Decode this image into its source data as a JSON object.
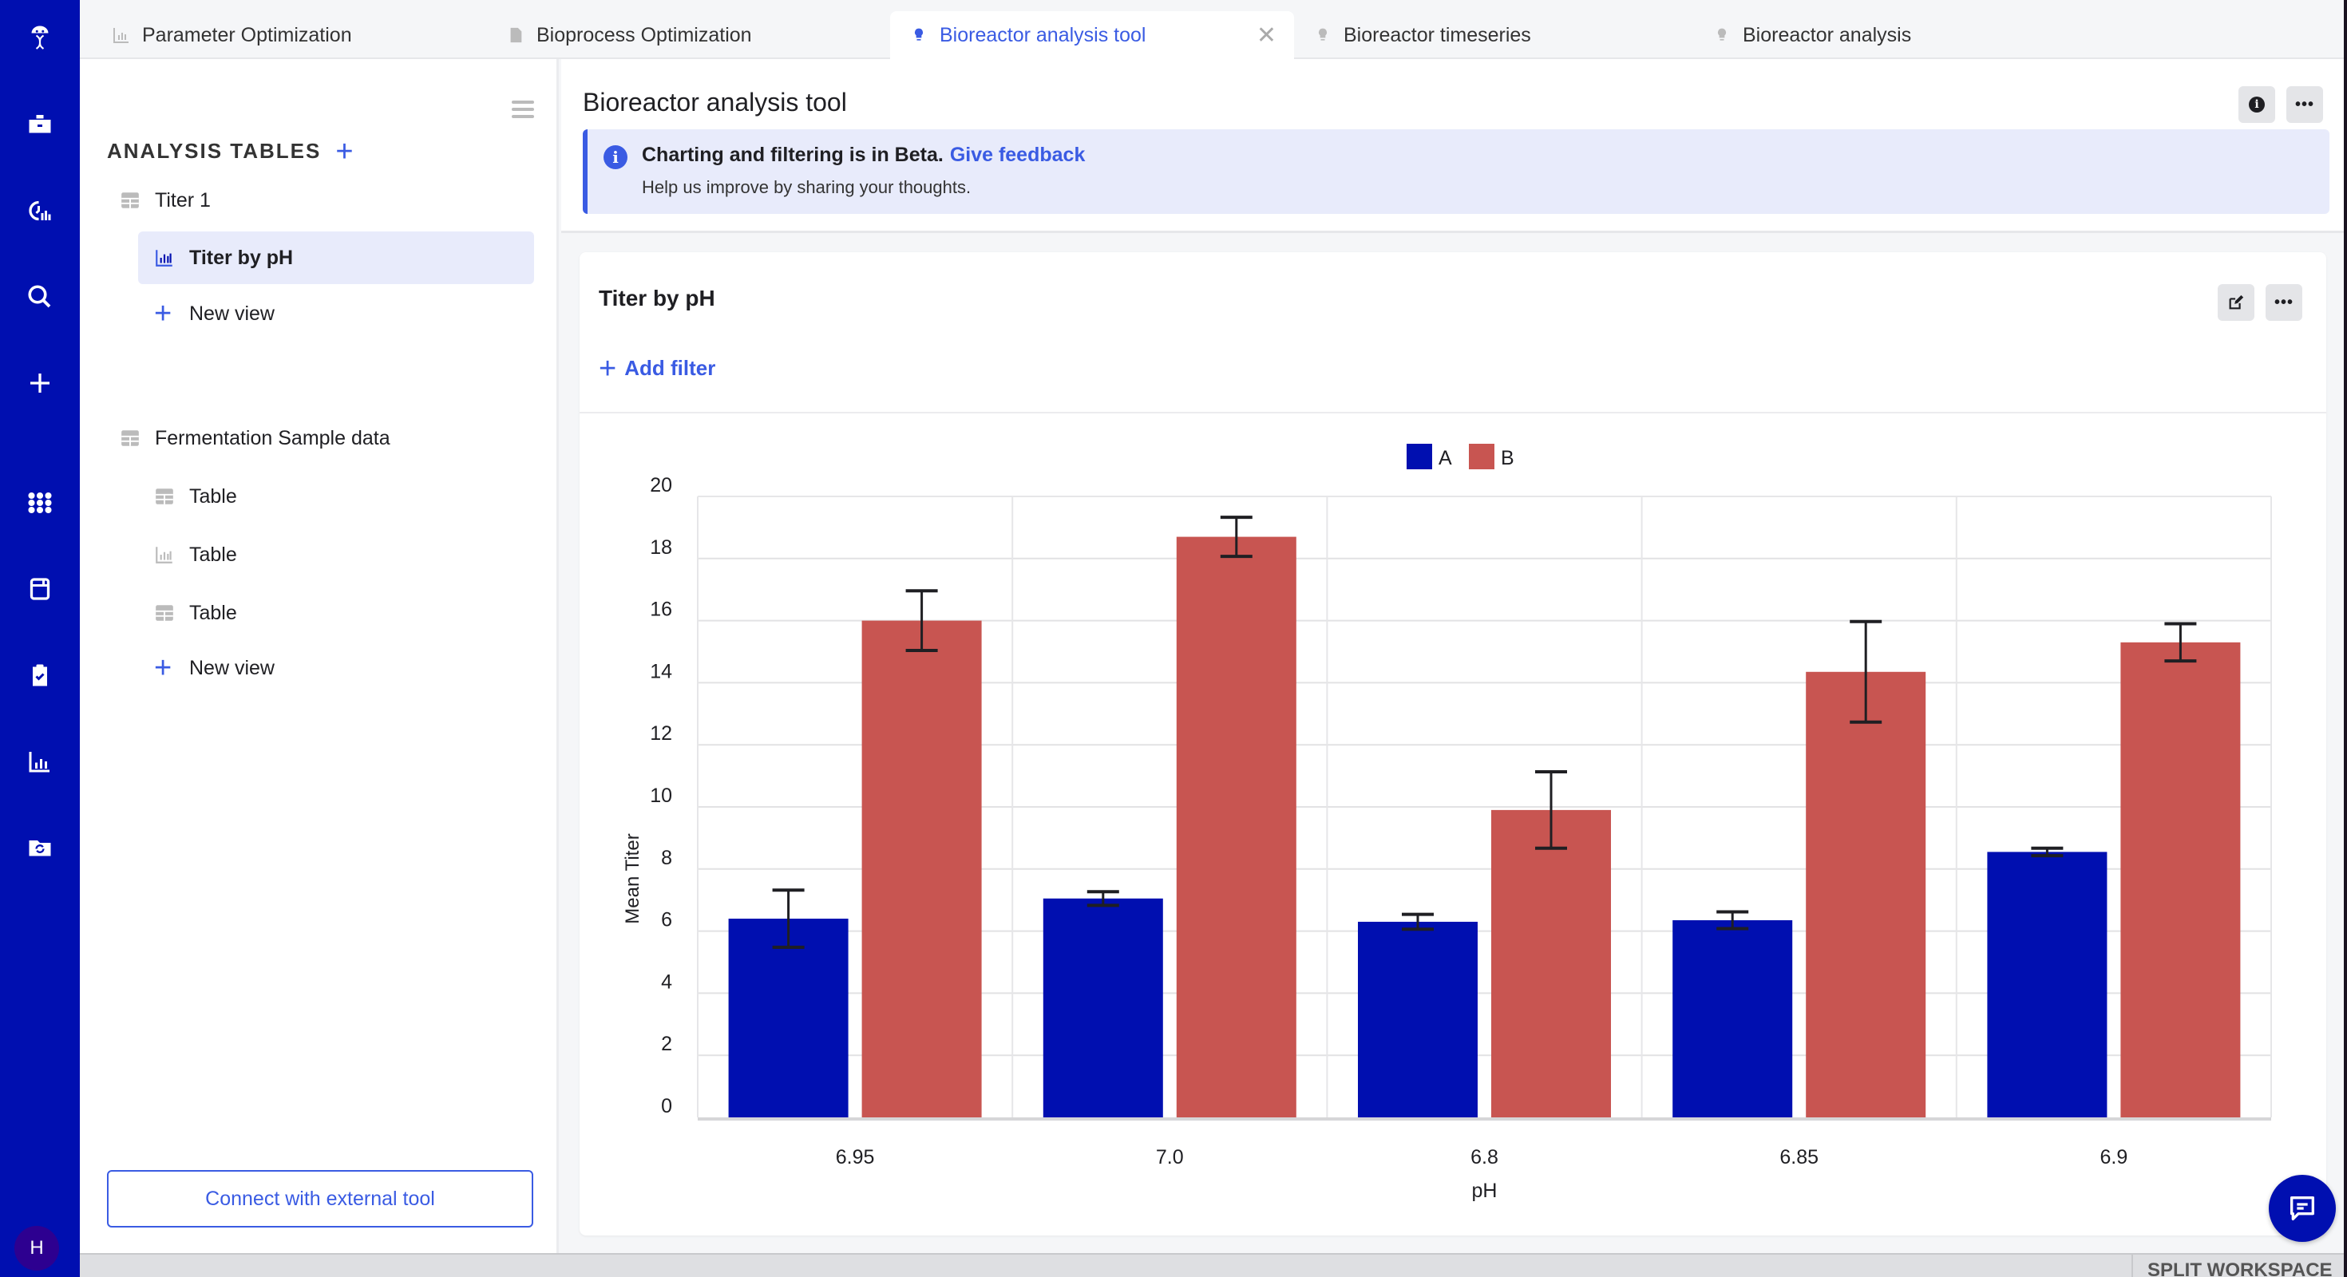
{
  "tabs": [
    {
      "label": "Parameter Optimization",
      "icon": "bar-chart-icon",
      "active": false
    },
    {
      "label": "Bioprocess Optimization",
      "icon": "document-icon",
      "active": false
    },
    {
      "label": "Bioreactor analysis tool",
      "icon": "lightbulb-icon",
      "active": true
    },
    {
      "label": "Bioreactor timeseries",
      "icon": "lightbulb-icon",
      "active": false
    },
    {
      "label": "Bioreactor analysis",
      "icon": "lightbulb-icon",
      "active": false
    }
  ],
  "rail": {
    "icons": [
      "logo-icon",
      "briefcase-icon",
      "analytics-icon",
      "search-icon",
      "plus-icon",
      "apps-grid-icon",
      "notebook-icon",
      "clipboard-check-icon",
      "bar-chart-icon",
      "folder-sync-icon"
    ],
    "avatar_initial": "H"
  },
  "left_panel": {
    "section_title": "ANALYSIS TABLES",
    "items": [
      {
        "label": "Titer 1",
        "icon": "table-icon",
        "level": 0
      },
      {
        "label": "Titer by pH",
        "icon": "bar-chart-icon",
        "level": 1,
        "selected": true
      },
      {
        "label": "New view",
        "icon": "plus-icon",
        "level": 1
      },
      {
        "label": "Fermentation Sample data",
        "icon": "table-icon",
        "level": 0
      },
      {
        "label": "Table",
        "icon": "table-icon",
        "level": 1
      },
      {
        "label": "Table",
        "icon": "bar-chart-icon",
        "level": 1
      },
      {
        "label": "Table",
        "icon": "table-icon",
        "level": 1
      },
      {
        "label": "New view",
        "icon": "plus-icon",
        "level": 1
      }
    ],
    "connect_button": "Connect with external tool"
  },
  "header": {
    "title": "Bioreactor analysis tool",
    "banner_title": "Charting and filtering is in Beta.",
    "banner_link": "Give feedback",
    "banner_sub": "Help us improve by sharing your thoughts."
  },
  "card": {
    "title": "Titer by pH",
    "add_filter": "Add filter"
  },
  "footer": {
    "split_workspace": "SPLIT WORKSPACE"
  },
  "colors": {
    "A": "#000fb0",
    "B": "#c85551",
    "accent": "#3a5be3"
  },
  "chart_data": {
    "type": "bar",
    "title": "Titer by pH",
    "xlabel": "pH",
    "ylabel": "Mean Titer",
    "ylim": [
      0,
      20
    ],
    "yticks": [
      0,
      2,
      4,
      6,
      8,
      10,
      12,
      14,
      16,
      18,
      20
    ],
    "grid": true,
    "legend_position": "top-center",
    "categories": [
      "6.95",
      "7.0",
      "6.8",
      "6.85",
      "6.9"
    ],
    "series": [
      {
        "name": "A",
        "values": [
          6.4,
          7.05,
          6.3,
          6.35,
          8.55
        ],
        "error": [
          0.92,
          0.22,
          0.24,
          0.27,
          0.12
        ]
      },
      {
        "name": "B",
        "values": [
          16.0,
          18.7,
          9.9,
          14.35,
          15.3
        ],
        "error": [
          0.96,
          0.63,
          1.23,
          1.62,
          0.6
        ]
      }
    ]
  }
}
